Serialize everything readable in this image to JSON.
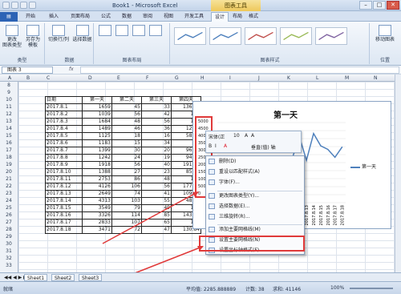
{
  "window": {
    "title": "Book1 - Microsoft Excel",
    "tools_label": "图表工具"
  },
  "tabs": [
    "开始",
    "插入",
    "页面布局",
    "公式",
    "数据",
    "审阅",
    "视图",
    "开发工具",
    "设计",
    "布局",
    "格式"
  ],
  "ribbon": {
    "group_type": {
      "label": "类型",
      "btn1": "更改\n图表类型",
      "btn2": "另存为\n模板"
    },
    "group_data": {
      "label": "数据",
      "btn1": "切换行/列",
      "btn2": "选择数据"
    },
    "group_layout": {
      "label": "图表布局"
    },
    "group_styles": {
      "label": "图表样式"
    },
    "group_location": {
      "label": "位置",
      "btn1": "移动图表"
    }
  },
  "namebar": {
    "name_box": "图表 3",
    "fx": "fx"
  },
  "columns": [
    "A",
    "B",
    "C",
    "D",
    "E",
    "F",
    "G",
    "H",
    "I",
    "J",
    "K",
    "L",
    "M",
    "N"
  ],
  "rows": [
    "8",
    "9",
    "10",
    "11",
    "12",
    "13",
    "14",
    "15",
    "16",
    "17",
    "18",
    "19",
    "20",
    "21",
    "22",
    "23",
    "24",
    "25",
    "26",
    "27",
    "28",
    "29",
    "30",
    "31",
    "32",
    "33"
  ],
  "table": {
    "header": [
      "日期",
      "第一天",
      "第二天",
      "第三天",
      "第四天"
    ],
    "rows": [
      [
        "2017.8.1",
        "1659",
        "45",
        "33",
        "136.81"
      ],
      [
        "2017.8.2",
        "1039",
        "56",
        "42",
        "160"
      ],
      [
        "2017.8.3",
        "1684",
        "48",
        "56",
        "150"
      ],
      [
        "2017.8.4",
        "1489",
        "46",
        "36",
        "129.4"
      ],
      [
        "2017.8.5",
        "1125",
        "18",
        "16",
        "58.51"
      ],
      [
        "2017.8.6",
        "1183",
        "15",
        "34",
        "26"
      ],
      [
        "2017.8.7",
        "1399",
        "30",
        "20",
        "96.09"
      ],
      [
        "2017.8.8",
        "1242",
        "24",
        "19",
        "94.19"
      ],
      [
        "2017.8.9",
        "1918",
        "56",
        "40",
        "191.07"
      ],
      [
        "2017.8.10",
        "1388",
        "27",
        "23",
        "85.05"
      ],
      [
        "2017.8.11",
        "2753",
        "86",
        "48",
        "150"
      ],
      [
        "2017.8.12",
        "4126",
        "106",
        "56",
        "177.15"
      ],
      [
        "2017.8.13",
        "2649",
        "74",
        "41",
        "109.96"
      ],
      [
        "2017.8.14",
        "4313",
        "103",
        "55",
        "48.47"
      ],
      [
        "2017.8.15",
        "3549",
        "79",
        "49",
        "120"
      ],
      [
        "2017.8.16",
        "3326",
        "114",
        "85",
        "143.61"
      ],
      [
        "2017.8.17",
        "2833",
        "107",
        "65",
        "170"
      ],
      [
        "2017.8.18",
        "3471",
        "72",
        "47",
        "130.84"
      ]
    ]
  },
  "chart_data": {
    "type": "line",
    "title": "第一天",
    "categories": [
      "2017.8.1",
      "2017.8.2",
      "2017.8.3",
      "2017.8.4",
      "2017.8.5",
      "2017.8.6",
      "2017.8.7",
      "2017.8.8",
      "2017.8.9",
      "2017.8.10",
      "2017.8.11",
      "2017.8.12",
      "2017.8.13",
      "2017.8.14",
      "2017.8.15",
      "2017.8.16",
      "2017.8.17",
      "2017.8.18"
    ],
    "visible_x_labels": [
      "2017.8.12",
      "2017.8.13",
      "2017.8.14",
      "2017.8.15",
      "2017.8.16",
      "2017.8.17",
      "2017.8.18"
    ],
    "series": [
      {
        "name": "第一天",
        "values": [
          1659,
          1039,
          1684,
          1489,
          1125,
          1183,
          1399,
          1242,
          1918,
          1388,
          2753,
          4126,
          2649,
          4313,
          3549,
          3326,
          2833,
          3471
        ]
      }
    ],
    "ylim": [
      0,
      5000
    ],
    "y_ticks": [
      "5000",
      "4500",
      "4000",
      "3500",
      "3000",
      "2500",
      "2000",
      "1500",
      "1000",
      "500",
      "0"
    ],
    "legend_position": "right",
    "color": "#4f81bd"
  },
  "mini_toolbar": {
    "font_size": "10",
    "row1_label": "宋体(正",
    "row2_label": "垂直(值) 轴"
  },
  "context_menu": [
    {
      "label": "删除(D)",
      "icon": "delete-icon"
    },
    {
      "label": "重设以匹配样式(A)",
      "icon": "reset-icon"
    },
    {
      "label": "字体(F)...",
      "icon": "font-icon"
    },
    {
      "label": "更改图表类型(Y)...",
      "icon": "chart-type-icon"
    },
    {
      "label": "选择数据(E)...",
      "icon": "select-data-icon"
    },
    {
      "label": "三维旋转(R)...",
      "icon": "rotate-icon"
    },
    {
      "label": "添加主要网格线(M)",
      "icon": "gridline-icon"
    },
    {
      "label": "设置主要网格线(N)",
      "icon": "gridline-icon"
    },
    {
      "label": "设置坐标轴格式(F)...",
      "icon": "format-axis-icon"
    }
  ],
  "sheet_tabs": [
    "Sheet1",
    "Sheet2",
    "Sheet3"
  ],
  "status": {
    "mode": "就绪",
    "average": "平均值: 2285.888889",
    "count": "计数: 38",
    "sum": "求和: 41146",
    "zoom": "100%"
  }
}
